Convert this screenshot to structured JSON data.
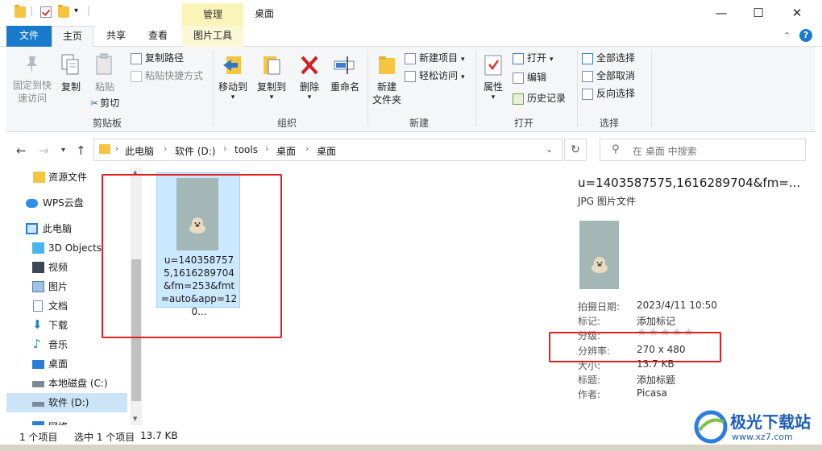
{
  "window": {
    "title": "桌面",
    "context_tab": "管理",
    "minimize": "—",
    "maximize": "☐",
    "close": "✕"
  },
  "ribbon_tabs": [
    "文件",
    "主页",
    "共享",
    "查看",
    "图片工具"
  ],
  "ribbon": {
    "clipboard": {
      "label": "剪贴板",
      "pin": [
        "固定到快",
        "速访问"
      ],
      "copy": "复制",
      "paste": "粘贴",
      "copy_path": "复制路径",
      "paste_shortcut": "粘贴快捷方式",
      "cut": "剪切"
    },
    "organize": {
      "label": "组织",
      "move_to": "移动到",
      "copy_to": "复制到",
      "delete": "删除",
      "rename": "重命名"
    },
    "new": {
      "label": "新建",
      "new_folder": [
        "新建",
        "文件夹"
      ],
      "new_item": "新建项目",
      "easy_access": "轻松访问"
    },
    "open": {
      "label": "打开",
      "properties": "属性",
      "open": "打开",
      "edit": "编辑",
      "history": "历史记录"
    },
    "select": {
      "label": "选择",
      "select_all": "全部选择",
      "select_none": "全部取消",
      "invert": "反向选择"
    }
  },
  "address": {
    "segments": [
      "此电脑",
      "软件 (D:)",
      "tools",
      "桌面",
      "桌面"
    ],
    "search_placeholder": "在 桌面 中搜索"
  },
  "nav_pane": [
    {
      "label": "资源文件",
      "icon": "folder-icon"
    },
    {
      "label": "WPS云盘",
      "icon": "cloud-icon"
    },
    {
      "label": "此电脑",
      "icon": "computer-icon"
    },
    {
      "label": "3D Objects",
      "icon": "cube-icon"
    },
    {
      "label": "视频",
      "icon": "video-icon"
    },
    {
      "label": "图片",
      "icon": "picture-icon"
    },
    {
      "label": "文档",
      "icon": "document-icon"
    },
    {
      "label": "下载",
      "icon": "download-icon"
    },
    {
      "label": "音乐",
      "icon": "music-icon"
    },
    {
      "label": "桌面",
      "icon": "desktop-icon"
    },
    {
      "label": "本地磁盘 (C:)",
      "icon": "drive-icon"
    },
    {
      "label": "软件 (D:)",
      "icon": "drive-icon"
    },
    {
      "label": "网络",
      "icon": "network-icon"
    }
  ],
  "file": {
    "name": "u=1403587575,1616289704&fm=253&fmt=auto&app=120..."
  },
  "details": {
    "name": "u=1403587575,1616289704&fm=...",
    "type": "JPG 图片文件",
    "props": [
      {
        "label": "拍摄日期:",
        "value": "2023/4/11 10:50"
      },
      {
        "label": "标记:",
        "value": "添加标记"
      },
      {
        "label": "分级:",
        "value": "★★★★★"
      },
      {
        "label": "分辨率:",
        "value": "270 x 480"
      },
      {
        "label": "大小:",
        "value": "13.7 KB"
      },
      {
        "label": "标题:",
        "value": "添加标题"
      },
      {
        "label": "作者:",
        "value": "Picasa"
      }
    ]
  },
  "status": {
    "count": "1 个项目",
    "selected": "选中 1 个项目",
    "size": "13.7 KB"
  },
  "watermark": {
    "brand": "极光下载站",
    "url": "www.xz7.com"
  }
}
